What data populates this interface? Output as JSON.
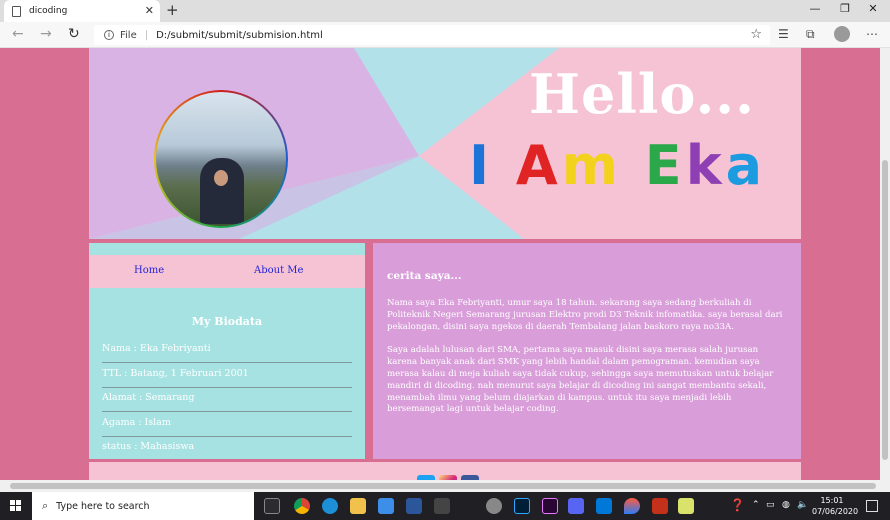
{
  "browser": {
    "tab_title": "dicoding",
    "tab_close": "✕",
    "new_tab": "+",
    "scheme_label": "File",
    "url": "D:/submit/submit/submision.html",
    "window_controls": [
      "—",
      "❐",
      "✕"
    ]
  },
  "banner": {
    "hello": "Hello...",
    "iam_letters": [
      {
        "char": "I",
        "color": "#1d73d6"
      },
      {
        "char": " ",
        "color": "#ffffff"
      },
      {
        "char": "A",
        "color": "#e02424"
      },
      {
        "char": "m",
        "color": "#f2d21c"
      },
      {
        "char": " ",
        "color": "#ffffff"
      },
      {
        "char": "E",
        "color": "#2aa84a"
      },
      {
        "char": "k",
        "color": "#8e3fb3"
      },
      {
        "char": "a",
        "color": "#1d9be0"
      }
    ]
  },
  "nav": {
    "home": "Home",
    "about": "About Me"
  },
  "biodata": {
    "title": "My Biodata",
    "rows": [
      "Nama : Eka Febriyanti",
      "TTL : Batang, 1 Februari 2001",
      "Alamat : Semarang",
      "Agama : Islam",
      "status : Mahasiswa"
    ]
  },
  "story": {
    "title": "cerita saya...",
    "paragraphs": [
      "Nama saya Eka Febriyanti, umur saya 18 tahun. sekarang saya sedang berkuliah di Politeknik Negeri Semarang jurusan Elektro prodi D3 Teknik infomatika. saya berasal dari pekalongan, disini saya ngekos di daerah Tembalang jalan baskoro raya no33A.",
      "Saya adalah lulusan dari SMA, pertama saya masuk disini saya merasa salah jurusan karena banyak anak dari SMK yang lebih handal dalam pemograman. kemudian saya merasa kalau di meja kuliah saya tidak cukup, sehingga saya memutuskan untuk belajar mandiri di dicoding. nah menurut saya belajar di dicoding ini sangat membantu sekali, menambah ilmu yang belum diajarkan di kampus. untuk itu saya menjadi lebih bersemangat lagi untuk belajar coding."
    ]
  },
  "colors": {
    "page_bg": "#d86f93",
    "panel_pink": "#f6c3d5",
    "panel_teal": "#a7e2e2",
    "panel_lilac": "#d99ed9",
    "link_blue": "#2525d6"
  },
  "taskbar": {
    "search_placeholder": "Type here to search",
    "time": "15:01",
    "date": "07/06/2020"
  }
}
